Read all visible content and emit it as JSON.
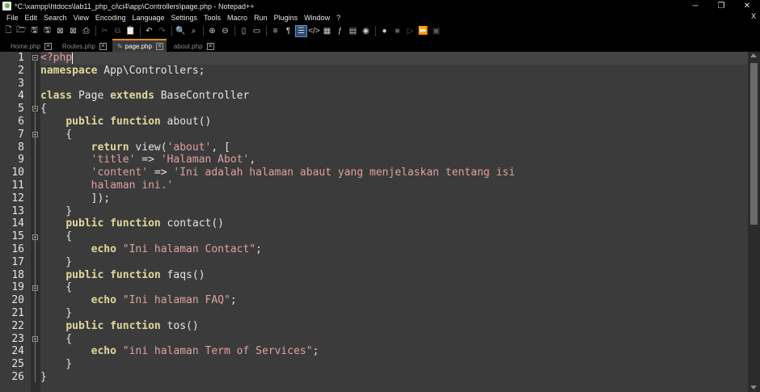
{
  "window": {
    "title": "*C:\\xampp\\htdocs\\lab11_php_ci\\ci4\\app\\Controllers\\page.php - Notepad++",
    "minimize": "─",
    "restore": "❐",
    "close": "✕"
  },
  "menu": {
    "items": [
      "File",
      "Edit",
      "Search",
      "View",
      "Encoding",
      "Language",
      "Settings",
      "Tools",
      "Macro",
      "Run",
      "Plugins",
      "Window",
      "?"
    ],
    "close_doc": "X"
  },
  "tabs": [
    {
      "label": "Home.php",
      "close": "✕"
    },
    {
      "label": "Routes.php",
      "close": "✕"
    },
    {
      "label": "page.php",
      "close": "✕"
    },
    {
      "label": "about.php",
      "close": "✕"
    }
  ],
  "editor": {
    "line_numbers": [
      "1",
      "2",
      "3",
      "4",
      "5",
      "6",
      "7",
      "8",
      "9",
      "10",
      "11",
      "12",
      "13",
      "14",
      "15",
      "16",
      "17",
      "18",
      "19",
      "20",
      "21",
      "22",
      "23",
      "24",
      "25",
      "26"
    ],
    "lines": {
      "l1_tag": "<?php",
      "l2_kw": "namespace",
      "l2_rest": " App\\Controllers;",
      "l4_kw1": "class",
      "l4_mid": " Page ",
      "l4_kw2": "extends",
      "l4_rest": " BaseController",
      "l5": "{",
      "l6_indent": "    ",
      "l6_kw1": "public",
      "l6_sp": " ",
      "l6_kw2": "function",
      "l6_rest": " about()",
      "l7": "    {",
      "l8_indent": "        ",
      "l8_kw": "return",
      "l8_mid": " view(",
      "l8_str": "'about'",
      "l8_rest": ", [",
      "l9_indent": "        ",
      "l9_str1": "'title'",
      "l9_mid": " => ",
      "l9_str2": "'Halaman Abot'",
      "l9_rest": ",",
      "l10_indent": "        ",
      "l10_str1": "'content'",
      "l10_mid": " => ",
      "l10_str2": "'Ini adalah halaman abaut yang menjelaskan tentang isi",
      "l11_indent": "        ",
      "l11_str": "halaman ini.'",
      "l12": "        ]);",
      "l13": "    }",
      "l14_indent": "    ",
      "l14_kw1": "public",
      "l14_sp": " ",
      "l14_kw2": "function",
      "l14_rest": " contact()",
      "l15": "    {",
      "l16_indent": "        ",
      "l16_kw": "echo",
      "l16_sp": " ",
      "l16_str": "\"Ini halaman Contact\"",
      "l16_rest": ";",
      "l17": "    }",
      "l18_indent": "    ",
      "l18_kw1": "public",
      "l18_sp": " ",
      "l18_kw2": "function",
      "l18_rest": " faqs()",
      "l19": "    {",
      "l20_indent": "        ",
      "l20_kw": "echo",
      "l20_sp": " ",
      "l20_str": "\"Ini halaman FAQ\"",
      "l20_rest": ";",
      "l21": "    }",
      "l22_indent": "    ",
      "l22_kw1": "public",
      "l22_sp": " ",
      "l22_kw2": "function",
      "l22_rest": " tos()",
      "l23": "    {",
      "l24_indent": "        ",
      "l24_kw": "echo",
      "l24_sp": " ",
      "l24_str": "\"ini halaman Term of Services\"",
      "l24_rest": ";",
      "l25": "    }",
      "l26": "}"
    }
  },
  "colors": {
    "editor_bg": "#3b3b3b",
    "keyword": "#e0d89c",
    "string": "#e0a0a0",
    "active_tab_accent": "#e08a2c"
  },
  "toolbar_icons": [
    "new-file-icon",
    "open-file-icon",
    "save-icon",
    "save-all-icon",
    "close-icon",
    "close-all-icon",
    "print-icon",
    "cut-icon",
    "copy-icon",
    "paste-icon",
    "undo-icon",
    "redo-icon",
    "find-icon",
    "replace-icon",
    "zoom-in-icon",
    "zoom-out-icon",
    "sync-v-icon",
    "sync-h-icon",
    "word-wrap-icon",
    "show-all-chars-icon",
    "indent-guide-icon",
    "xml-tag-icon",
    "map-icon",
    "function-list-icon",
    "folder-workspace-icon",
    "monitor-icon",
    "record-macro-icon",
    "stop-record-icon",
    "play-macro-icon",
    "run-macro-multiple-icon",
    "save-macro-icon"
  ]
}
